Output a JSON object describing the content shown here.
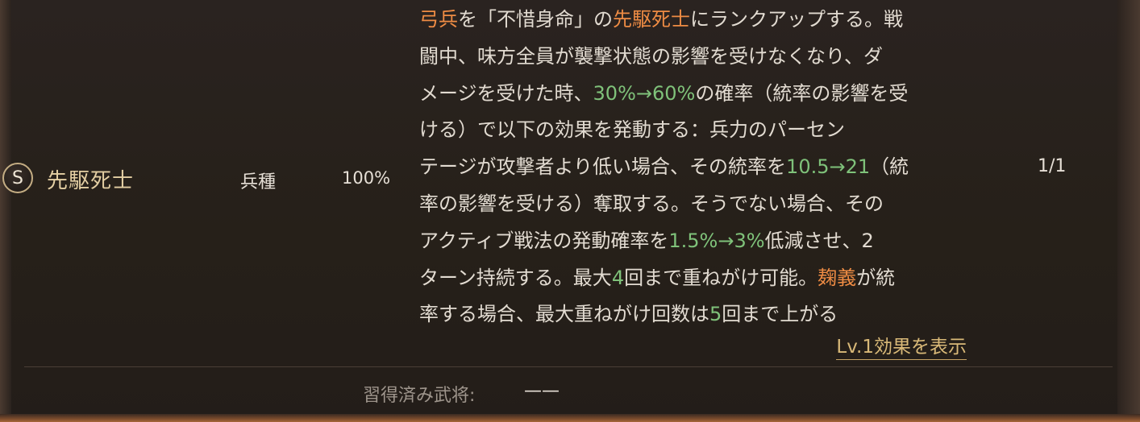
{
  "skill": {
    "grade": "S",
    "name": "先駆死士",
    "type": "兵種",
    "rate": "100%",
    "count": "1/1"
  },
  "description": {
    "lines": [
      [
        {
          "text": "弓兵",
          "style": "orange"
        },
        {
          "text": "を「不惜身命」の",
          "style": "normal"
        },
        {
          "text": "先駆死士",
          "style": "orange"
        },
        {
          "text": "にランクアップする。戦",
          "style": "normal"
        }
      ],
      [
        {
          "text": "闘中、味方全員が襲撃状態の影響を受けなくなり、ダ",
          "style": "normal"
        }
      ],
      [
        {
          "text": "メージを受けた時、",
          "style": "normal"
        },
        {
          "text": "30%→60%",
          "style": "green"
        },
        {
          "text": "の確率（統率の影響を受",
          "style": "normal"
        }
      ],
      [
        {
          "text": "ける）で以下の効果を発動する：兵力のパーセン",
          "style": "normal"
        }
      ],
      [
        {
          "text": "テージが攻撃者より低い場合、その統率を",
          "style": "normal"
        },
        {
          "text": "10.5→21",
          "style": "green"
        },
        {
          "text": "（統",
          "style": "normal"
        }
      ],
      [
        {
          "text": "率の影響を受ける）奪取する。そうでない場合、その",
          "style": "normal"
        }
      ],
      [
        {
          "text": "アクティブ戦法の発動確率を",
          "style": "normal"
        },
        {
          "text": "1.5%→3%",
          "style": "green"
        },
        {
          "text": "低減させ、2",
          "style": "normal"
        }
      ],
      [
        {
          "text": "ターン持続する。最大",
          "style": "normal"
        },
        {
          "text": "4",
          "style": "green"
        },
        {
          "text": "回まで重ねがけ可能。",
          "style": "normal"
        },
        {
          "text": "麹義",
          "style": "orange"
        },
        {
          "text": "が統",
          "style": "normal"
        }
      ],
      [
        {
          "text": "率する場合、最大重ねがけ回数は",
          "style": "normal"
        },
        {
          "text": "5",
          "style": "green"
        },
        {
          "text": "回まで上がる",
          "style": "normal"
        }
      ]
    ]
  },
  "lv_link": "Lv.1効果を表示",
  "learned": {
    "label": "習得済み武将:",
    "value": "——"
  },
  "colors": {
    "orange": "#ef8c44",
    "green": "#7fc27a",
    "gold": "#d9b978",
    "text": "#e2dbd1"
  }
}
